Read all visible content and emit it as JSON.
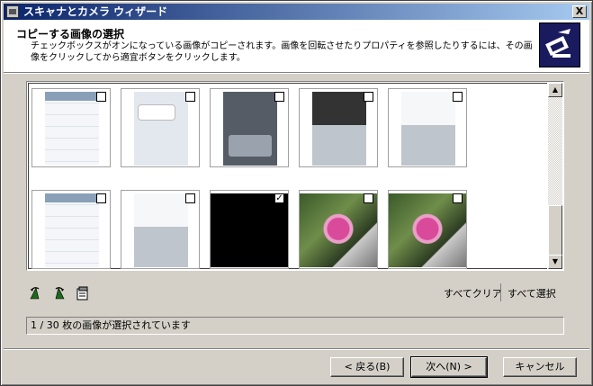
{
  "window": {
    "title": "スキャナとカメラ ウィザード",
    "close_glyph": "X"
  },
  "header": {
    "title": "コピーする画像の選択",
    "description": "チェックボックスがオンになっている画像がコピーされます。画像を回転させたりプロパティを参照したりするには、その画像をクリックしてから適宜ボタンをクリックします。"
  },
  "thumbnails": [
    {
      "kind": "list",
      "checked": false
    },
    {
      "kind": "message",
      "checked": false
    },
    {
      "kind": "dark-menu",
      "checked": false
    },
    {
      "kind": "keyboard-dark",
      "checked": false
    },
    {
      "kind": "keyboard-light",
      "checked": false
    },
    {
      "kind": "list",
      "checked": false
    },
    {
      "kind": "keyboard-light",
      "checked": false
    },
    {
      "kind": "black",
      "checked": true
    },
    {
      "kind": "flower",
      "checked": false
    },
    {
      "kind": "flower",
      "checked": false
    }
  ],
  "toolbar": {
    "rotate_left_icon": "rotate-left-icon",
    "rotate_right_icon": "rotate-right-icon",
    "properties_icon": "properties-icon"
  },
  "links": {
    "clear_all": "すべてクリア",
    "select_all": "すべて選択"
  },
  "status": "1 / 30 枚の画像が選択されています",
  "buttons": {
    "back": "< 戻る(B)",
    "next": "次へ(N) >",
    "cancel": "キャンセル"
  }
}
